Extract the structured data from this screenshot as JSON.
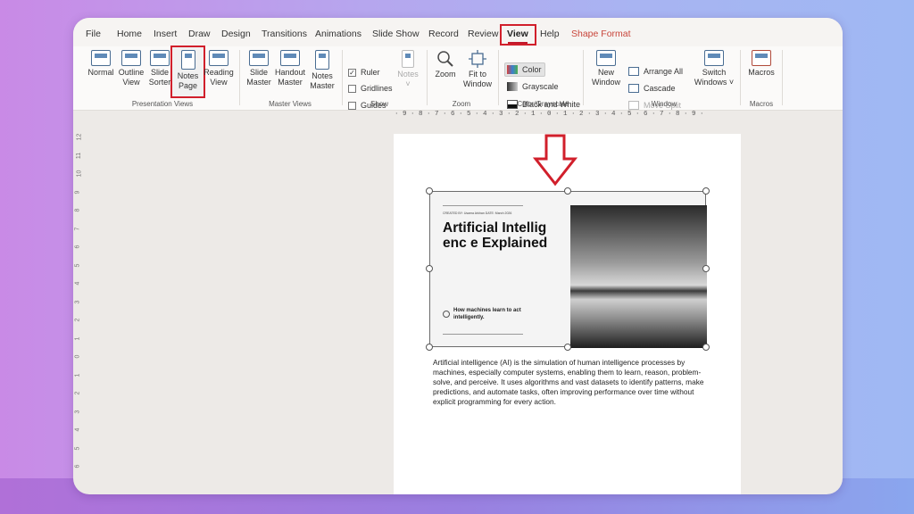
{
  "tabs": [
    "File",
    "Home",
    "Insert",
    "Draw",
    "Design",
    "Transitions",
    "Animations",
    "Slide Show",
    "Record",
    "Review",
    "View",
    "Help",
    "Shape Format"
  ],
  "presentation_views": {
    "group_label": "Presentation Views",
    "normal": "Normal",
    "outline": [
      "Outline",
      "View"
    ],
    "slide_sorter": [
      "Slide",
      "Sorter"
    ],
    "notes_page": [
      "Notes",
      "Page"
    ],
    "reading_view": [
      "Reading",
      "View"
    ]
  },
  "master_views": {
    "group_label": "Master Views",
    "slide_master": [
      "Slide",
      "Master"
    ],
    "handout_master": [
      "Handout",
      "Master"
    ],
    "notes_master": [
      "Notes",
      "Master"
    ]
  },
  "show": {
    "group_label": "Show",
    "ruler": "Ruler",
    "ruler_checked": true,
    "gridlines": "Gridlines",
    "guides": "Guides",
    "notes": "Notes"
  },
  "zoom": {
    "group_label": "Zoom",
    "zoom": "Zoom",
    "fit": [
      "Fit to",
      "Window"
    ]
  },
  "color_grayscale": {
    "group_label": "Color/Grayscale",
    "color": "Color",
    "grayscale": "Grayscale",
    "black_white": "Black and White"
  },
  "window": {
    "group_label": "Window",
    "new_window": [
      "New",
      "Window"
    ],
    "arrange_all": "Arrange All",
    "cascade": "Cascade",
    "move_split": "Move Split",
    "switch_windows": [
      "Switch",
      "Windows ˅"
    ]
  },
  "macros": {
    "group_label": "Macros",
    "macros": "Macros"
  },
  "ruler_top": "· 9 · 8 · 7 · 6 · 5 · 4 · 3 · 2 · 1 · 0 · 1 · 2 · 3 · 4 · 5 · 6 · 7 · 8 · 9 ·",
  "ruler_left": [
    "12",
    "11",
    "10",
    "9",
    "8",
    "7",
    "6",
    "5",
    "4",
    "3",
    "2",
    "1",
    "0",
    "1",
    "2",
    "3",
    "4",
    "5",
    "6"
  ],
  "slide": {
    "created": "CREATED BY: Usama Arkhan DATE: March 2026",
    "title": "Artificial Intelligenc e Explained",
    "subtitle": "How machines learn to act intelligently."
  },
  "notes": "Artificial intelligence (AI) is the simulation of human intelligence processes by machines, especially computer systems, enabling them to learn, reason, problem-solve, and perceive. It uses algorithms and vast datasets to identify patterns, make predictions, and automate tasks, often improving performance over time without explicit programming for every action.",
  "colors": {
    "highlight": "#d11f2b",
    "shape_format": "#c8453a",
    "window_bg": "#edeae7"
  }
}
